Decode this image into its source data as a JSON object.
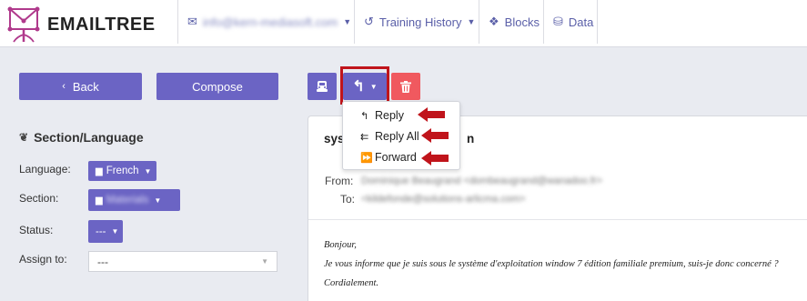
{
  "brand": {
    "name": "EMAILTREE",
    "accent": "#b03a8c"
  },
  "nav": {
    "account": {
      "icon": "envelope-icon",
      "label": "info@kern-mediasoft.com"
    },
    "training": {
      "icon": "history-icon",
      "label": "Training History"
    },
    "blocks": {
      "icon": "cubes-icon",
      "label": "Blocks"
    },
    "data": {
      "icon": "database-icon",
      "label": "Data"
    }
  },
  "toolbar": {
    "back_label": "Back",
    "compose_label": "Compose",
    "print_icon": "printer-icon",
    "reply_icon": "reply-icon",
    "delete_icon": "trash-icon",
    "primary_color": "#6b64c4",
    "danger_color": "#f0595f",
    "highlight_color": "#c0141b"
  },
  "reply_menu": {
    "items": [
      {
        "icon": "reply-icon",
        "label": "Reply"
      },
      {
        "icon": "reply-all-icon",
        "label": "Reply All"
      },
      {
        "icon": "forward-icon",
        "label": "Forward"
      }
    ]
  },
  "section_panel": {
    "title": "Section/Language",
    "language": {
      "label": "Language:",
      "value": "French"
    },
    "section": {
      "label": "Section:",
      "value": "Materials"
    },
    "status": {
      "label": "Status:",
      "value": "---"
    },
    "assign": {
      "label": "Assign to:",
      "value": "---"
    }
  },
  "email": {
    "subject_visible": "syst",
    "subject_tail": "n",
    "from_label": "From:",
    "from_value": "Dominique Beaugrand <dombeaugrand@wanadoo.fr>",
    "to_label": "To:",
    "to_value": "<kildefonde@solutions-arlicma.com>",
    "body": [
      "Bonjour,",
      "Je vous informe que je suis sous le système d'exploitation window 7 édition familiale premium, suis-je donc concerné ?",
      "Cordialement."
    ]
  }
}
